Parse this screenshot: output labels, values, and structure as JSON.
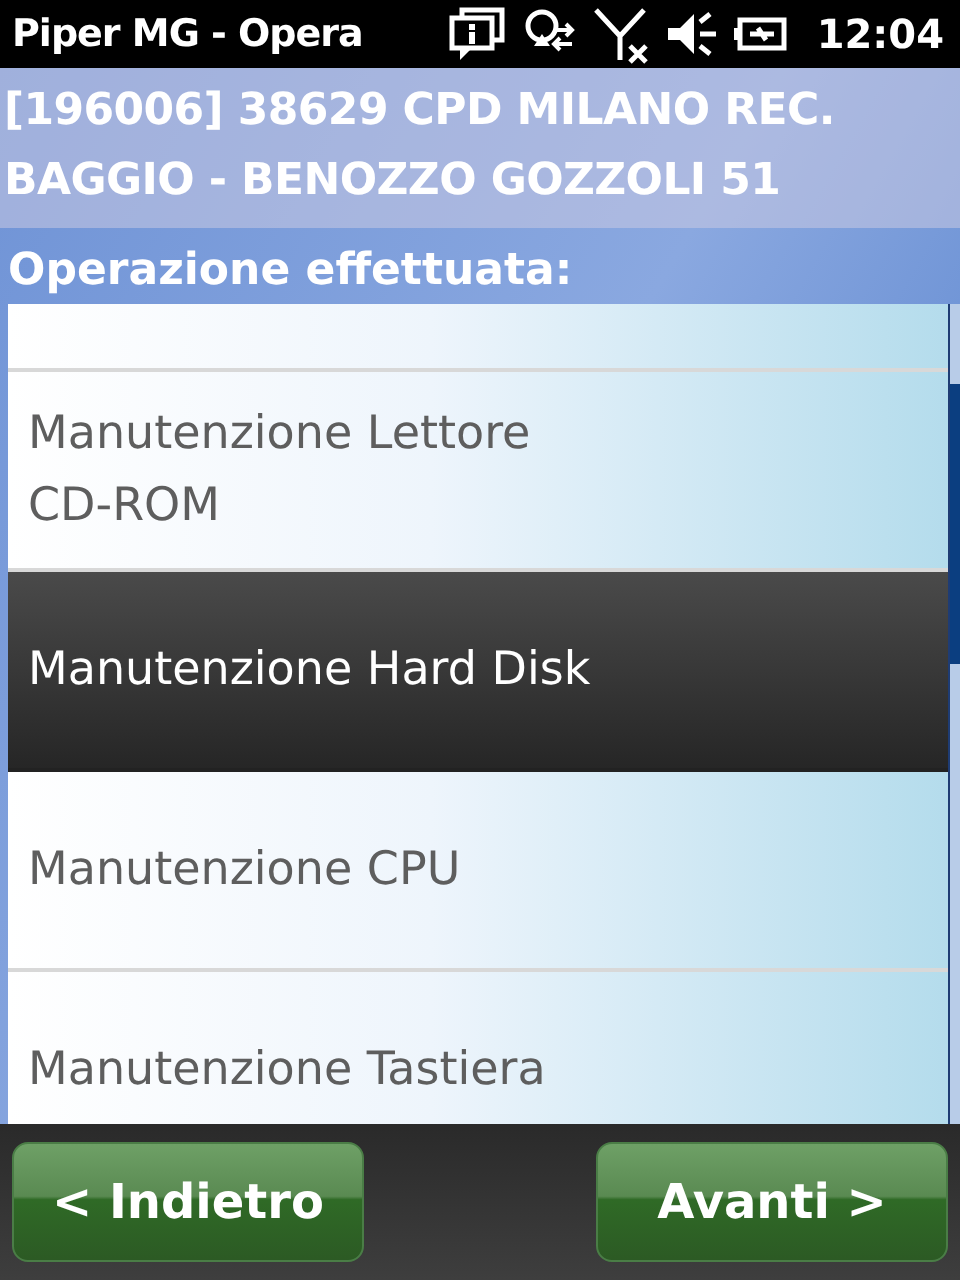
{
  "status_bar": {
    "title": "Piper MG - Opera",
    "time": "12:04"
  },
  "header": {
    "lines": [
      "[196006] 38629 CPD MILANO REC.",
      "BAGGIO - BENOZZO GOZZOLI 51"
    ]
  },
  "list_label": "Operazione effettuata:",
  "items": [
    {
      "label": "Manutenzione Lettore CD-ROM",
      "selected": false
    },
    {
      "label": "Manutenzione Hard Disk",
      "selected": true
    },
    {
      "label": "Manutenzione CPU",
      "selected": false
    },
    {
      "label": "Manutenzione Tastiera",
      "selected": false
    }
  ],
  "buttons": [
    {
      "label": "< Indietro"
    },
    {
      "label": "Avanti >"
    }
  ]
}
